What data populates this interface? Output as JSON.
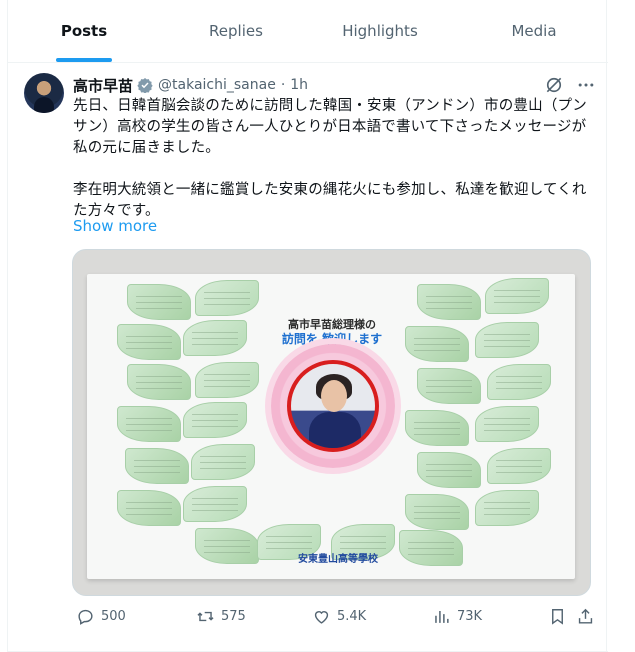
{
  "tabs": [
    {
      "label": "Posts",
      "active": true
    },
    {
      "label": "Replies",
      "active": false
    },
    {
      "label": "Highlights",
      "active": false
    },
    {
      "label": "Media",
      "active": false
    }
  ],
  "tweet": {
    "author_name": "高市早苗",
    "handle": "@takaichi_sanae",
    "separator": "·",
    "time": "1h",
    "paragraph1": "先日、日韓首脳会談のために訪問した韓国・安東（アンドン）市の豊山（プンサン）高校の学生の皆さん一人ひとりが日本語で書いて下さったメッセージが私の元に届きました。",
    "paragraph2": "李在明大統領と一緒に鑑賞した安東の縄花火にも参加し、私達を歓迎してくれた方々です。",
    "show_more": "Show more"
  },
  "media": {
    "card_title": "高市早苗総理様の",
    "card_subtitle": "訪問を 歓迎します",
    "school_label": "安東豊山高等學校"
  },
  "actions": {
    "replies": "500",
    "reposts": "575",
    "likes": "5.4K",
    "views": "73K"
  },
  "colors": {
    "accent": "#1d9bf0",
    "secondary_text": "#536471",
    "verified_badge": "#829aab"
  },
  "icons": [
    "verified-badge-icon",
    "grok-icon",
    "more-icon",
    "reply-icon",
    "repost-icon",
    "like-icon",
    "views-icon",
    "bookmark-icon",
    "share-icon"
  ]
}
